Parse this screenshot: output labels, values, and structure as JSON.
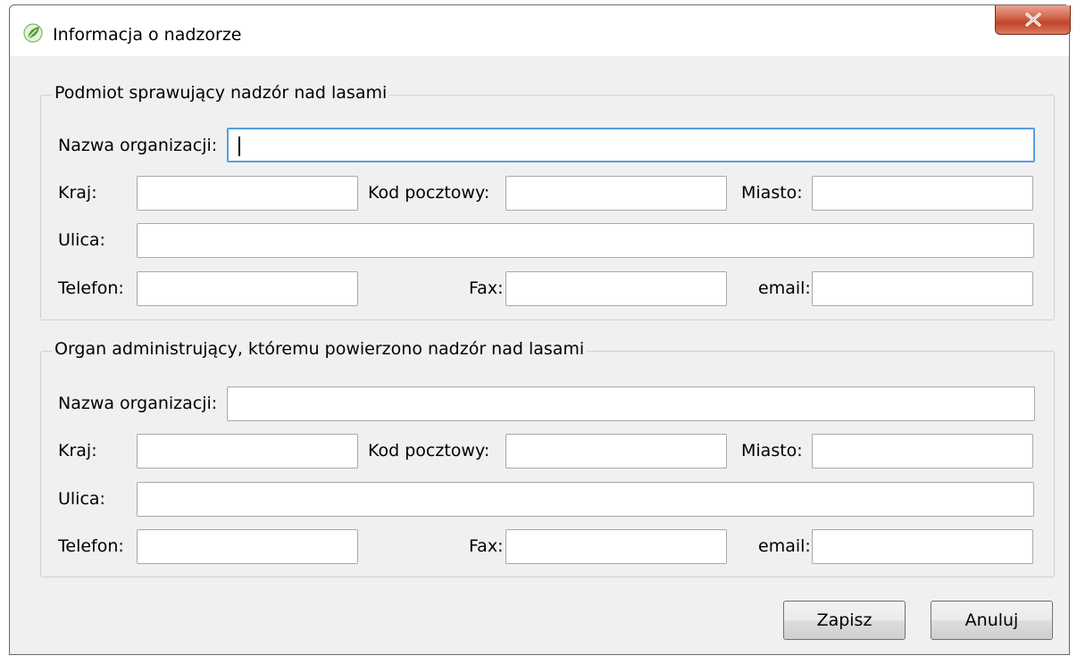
{
  "window": {
    "title": "Informacja o nadzorze",
    "close_symbol": "X"
  },
  "group1": {
    "title": "Podmiot sprawujący nadzór nad lasami",
    "labels": {
      "nazwa": "Nazwa organizacji:",
      "kraj": "Kraj:",
      "kod": "Kod pocztowy:",
      "miasto": "Miasto:",
      "ulica": "Ulica:",
      "telefon": "Telefon:",
      "fax": "Fax:",
      "email": "email:"
    },
    "values": {
      "nazwa": "",
      "kraj": "",
      "kod": "",
      "miasto": "",
      "ulica": "",
      "telefon": "",
      "fax": "",
      "email": ""
    }
  },
  "group2": {
    "title": "Organ administrujący, któremu powierzono nadzór nad lasami",
    "labels": {
      "nazwa": "Nazwa organizacji:",
      "kraj": "Kraj:",
      "kod": "Kod pocztowy:",
      "miasto": "Miasto:",
      "ulica": "Ulica:",
      "telefon": "Telefon:",
      "fax": "Fax:",
      "email": "email:"
    },
    "values": {
      "nazwa": "",
      "kraj": "",
      "kod": "",
      "miasto": "",
      "ulica": "",
      "telefon": "",
      "fax": "",
      "email": ""
    }
  },
  "buttons": {
    "save": "Zapisz",
    "cancel": "Anuluj"
  },
  "colors": {
    "focus_border": "#569de5",
    "close_button": "#c0442a",
    "window_bg": "#f0f0f0"
  },
  "icons": {
    "app": "leaf-icon",
    "close": "close-icon"
  }
}
